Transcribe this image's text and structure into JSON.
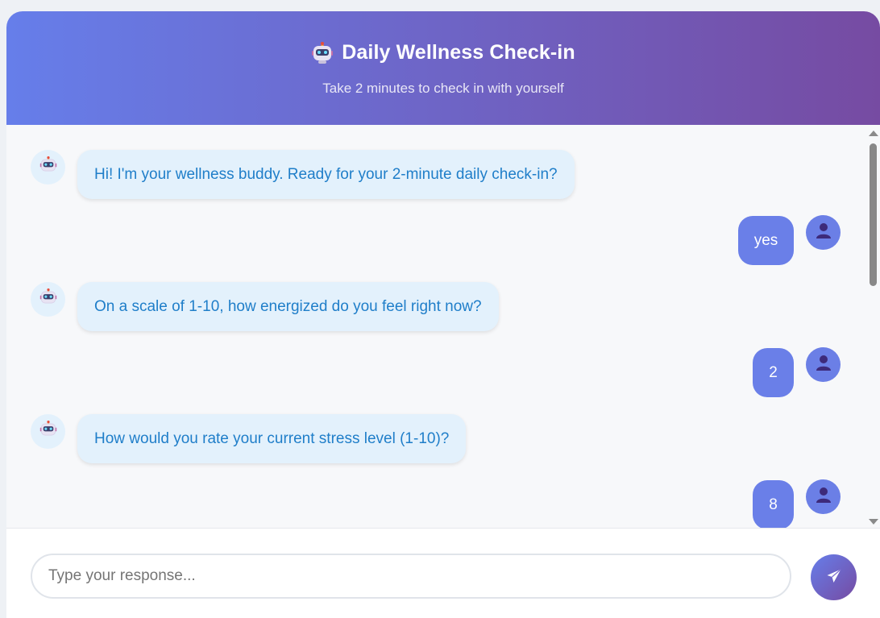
{
  "header": {
    "icon": "robot-icon",
    "title": "Daily Wellness Check-in",
    "subtitle": "Take 2 minutes to check in with yourself"
  },
  "messages": [
    {
      "sender": "bot",
      "text": "Hi! I'm your wellness buddy. Ready for your 2-minute daily check-in?",
      "avatar_icon": "robot-icon"
    },
    {
      "sender": "user",
      "text": "yes",
      "avatar_icon": "user-icon"
    },
    {
      "sender": "bot",
      "text": "On a scale of 1-10, how energized do you feel right now?",
      "avatar_icon": "robot-icon"
    },
    {
      "sender": "user",
      "text": "2",
      "avatar_icon": "user-icon"
    },
    {
      "sender": "bot",
      "text": "How would you rate your current stress level (1-10)?",
      "avatar_icon": "robot-icon"
    },
    {
      "sender": "user",
      "text": "8",
      "avatar_icon": "user-icon"
    }
  ],
  "input": {
    "value": "",
    "placeholder": "Type your response..."
  },
  "send_button": {
    "icon": "paper-plane-icon"
  },
  "colors": {
    "header_gradient_start": "#667eea",
    "header_gradient_end": "#764ba2",
    "bot_bubble_bg": "#e3f1fc",
    "bot_text": "#1f7ec9",
    "user_bubble_bg": "#6a7fe8",
    "user_text": "#ffffff",
    "chat_bg": "#f7f8fa"
  }
}
